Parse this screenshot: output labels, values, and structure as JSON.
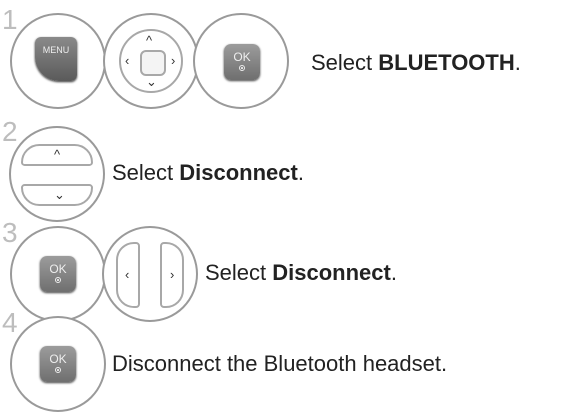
{
  "steps": [
    {
      "number": "1",
      "text_prefix": "Select ",
      "text_bold": "BLUETOOTH",
      "text_suffix": "."
    },
    {
      "number": "2",
      "text_prefix": "Select ",
      "text_bold": "Disconnect",
      "text_suffix": "."
    },
    {
      "number": "3",
      "text_prefix": "Select ",
      "text_bold": "Disconnect",
      "text_suffix": "."
    },
    {
      "number": "4",
      "text_prefix": "Disconnect the Bluetooth headset.",
      "text_bold": "",
      "text_suffix": ""
    }
  ],
  "buttons": {
    "menu_label": "MENU",
    "ok_label": "OK"
  }
}
